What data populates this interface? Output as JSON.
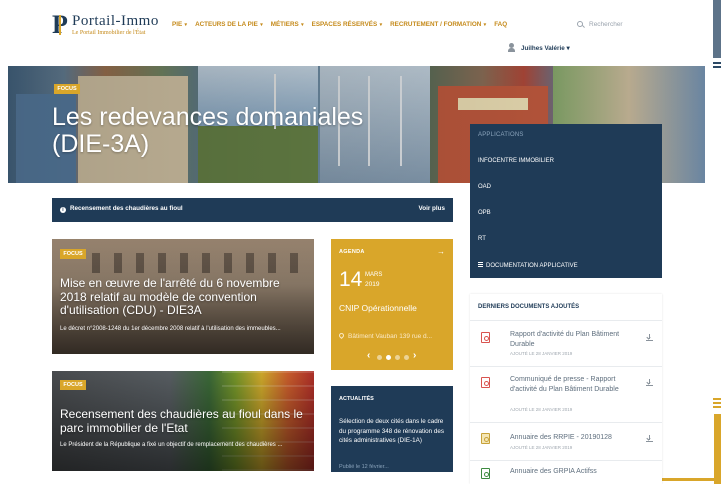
{
  "header": {
    "logo_title": "Portail-Immo",
    "logo_subtitle": "Le Portail Immobilier de l'État",
    "nav": [
      {
        "label": "PIE"
      },
      {
        "label": "ACTEURS DE LA PIE"
      },
      {
        "label": "MÉTIERS"
      },
      {
        "label": "ESPACES RÉSERVÉS"
      },
      {
        "label": "RECRUTEMENT / FORMATION"
      },
      {
        "label": "FAQ"
      }
    ],
    "search_placeholder": "Rechercher",
    "user_name": "Juilhes Valérie"
  },
  "hero": {
    "badge": "FOCUS",
    "title": "Les redevances domaniales (DIE-3A)"
  },
  "applications_menu": {
    "header": "APPLICATIONS",
    "items": [
      {
        "label": "INFOCENTRE IMMOBILIER"
      },
      {
        "label": "OAD"
      },
      {
        "label": "OPB"
      },
      {
        "label": "RT"
      },
      {
        "label": "DOCUMENTATION APPLICATIVE"
      }
    ]
  },
  "notice": {
    "text": "Recensement des chaudières au fioul",
    "link": "Voir plus"
  },
  "cards": [
    {
      "badge": "FOCUS",
      "title": "Mise en œuvre de l'arrêté du 6 novembre 2018 relatif au modèle de convention d'utilisation (CDU) - DIE3A",
      "desc": "Le décret n°2008-1248 du 1er décembre 2008 relatif à l'utilisation des immeubles..."
    },
    {
      "badge": "FOCUS",
      "title": "Recensement des chaudières au fioul dans le parc immobilier de l'Etat",
      "desc": "Le Président de la République a fixé un objectif de remplacement des chaudières ..."
    }
  ],
  "agenda": {
    "label": "AGENDA",
    "day": "14",
    "month": "MARS",
    "year": "2019",
    "event": "CNIP Opérationnelle",
    "place": "Bâtiment Vauban 139 rue d..."
  },
  "news": {
    "label": "ACTUALITÉS",
    "text": "Sélection de deux cités dans le cadre du programme 348 de rénovation des cités administratives (DIE-1A)",
    "date": "Publié le 12 février..."
  },
  "documents": {
    "header": "DERNIERS DOCUMENTS AJOUTÉS",
    "items": [
      {
        "title": "Rapport d'activité du Plan Bâtiment Durable",
        "date": "AJOUTÉ LE 28 JANVIER 2019",
        "icon": "pdf-file-icon"
      },
      {
        "title": "Communiqué de presse - Rapport d'activité du Plan Bâtiment Durable",
        "date": "AJOUTÉ LE 28 JANVIER 2019",
        "icon": "pdf-file-icon"
      },
      {
        "title": "Annuaire des RRPIE - 20190128",
        "date": "AJOUTÉ LE 28 JANVIER 2019",
        "icon": "image-file-icon"
      },
      {
        "title": "Annuaire des GRPIA Actifss",
        "date": "",
        "icon": "spreadsheet-file-icon"
      }
    ]
  },
  "colors": {
    "navy": "#1f3b57",
    "gold": "#d9a62a"
  }
}
